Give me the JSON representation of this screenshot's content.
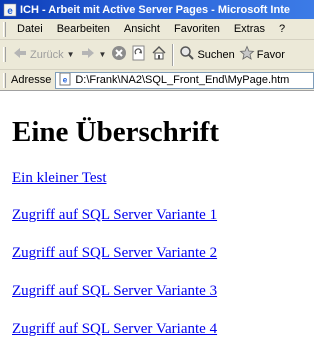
{
  "window": {
    "title": "ICH - Arbeit mit Active Server Pages - Microsoft Inte"
  },
  "menu": {
    "items": [
      "Datei",
      "Bearbeiten",
      "Ansicht",
      "Favoriten",
      "Extras",
      "?"
    ]
  },
  "toolbar": {
    "back_label": "Zurück",
    "search_label": "Suchen",
    "favorites_label": "Favor",
    "icons": [
      "back-arrow-icon",
      "forward-arrow-icon",
      "stop-icon",
      "refresh-icon",
      "home-icon",
      "search-icon",
      "favorites-icon"
    ]
  },
  "address": {
    "label": "Adresse",
    "value": "D:\\Frank\\NA2\\SQL_Front_End\\MyPage.htm"
  },
  "page": {
    "heading": "Eine Überschrift",
    "links": [
      "Ein kleiner Test",
      "Zugriff auf SQL Server Variante 1",
      "Zugriff auf SQL Server Variante 2",
      "Zugriff auf SQL Server Variante 3",
      "Zugriff auf SQL Server Variante 4"
    ]
  },
  "colors": {
    "titlebar": "#0a3ab5",
    "chrome": "#ece9d8",
    "link": "#0000ee"
  }
}
